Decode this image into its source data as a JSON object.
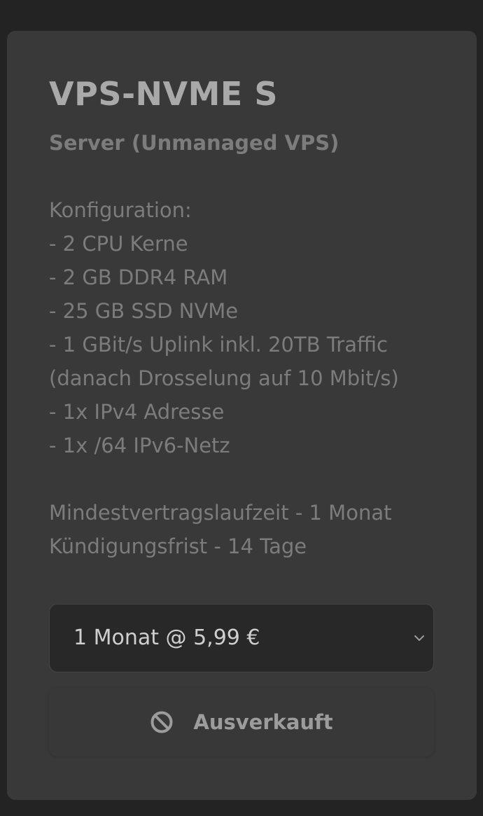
{
  "product": {
    "title": "VPS-NVME S",
    "subtitle": "Server (Unmanaged VPS)"
  },
  "configuration": {
    "heading": "Konfiguration:",
    "items": [
      "- 2 CPU Kerne",
      "- 2 GB DDR4 RAM",
      "- 25 GB SSD NVMe",
      "- 1 GBit/s Uplink inkl. 20TB Traffic",
      "(danach Drosselung auf 10 Mbit/s)",
      "- 1x IPv4 Adresse",
      "- 1x /64 IPv6-Netz"
    ]
  },
  "contract": {
    "min_term": "Mindestvertragslaufzeit - 1 Monat",
    "notice": "Kündigungsfrist - 14 Tage"
  },
  "billing_select": {
    "selected": "1 Monat @ 5,99 €",
    "icon": "chevron-down-icon"
  },
  "status_button": {
    "label": "Ausverkauft",
    "icon": "ban-icon"
  },
  "colors": {
    "page_background": "#232323",
    "card_background": "#393939",
    "select_background": "#282828"
  }
}
